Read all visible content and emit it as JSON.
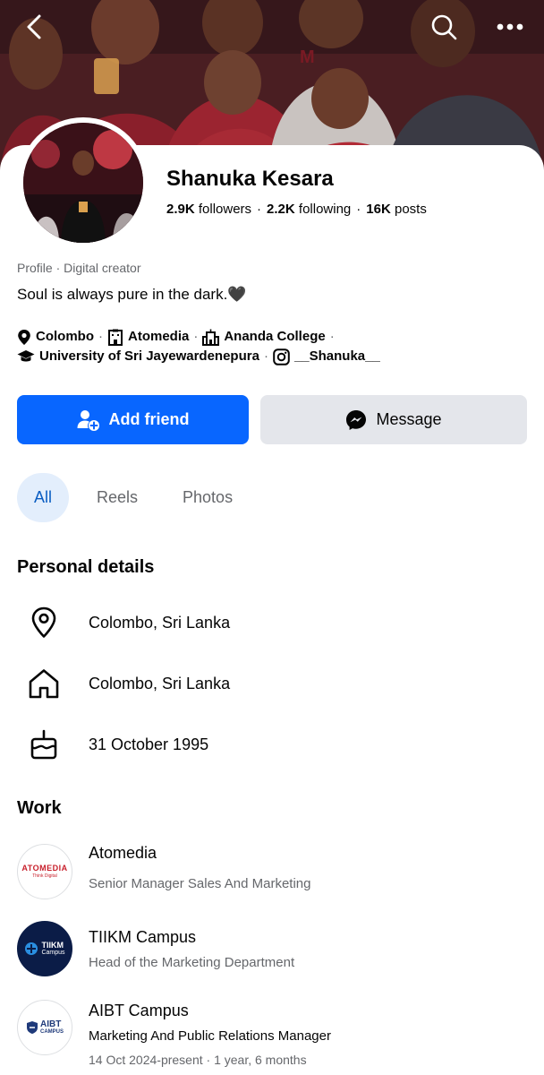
{
  "profile": {
    "name": "Shanuka Kesara",
    "followers_count": "2.9K",
    "followers_label": "followers",
    "following_count": "2.2K",
    "following_label": "following",
    "posts_count": "16K",
    "posts_label": "posts",
    "category": "Profile · Digital creator",
    "bio": "Soul is always pure in the dark.🖤"
  },
  "intro_links": [
    {
      "icon": "location-pin-icon",
      "label": "Colombo"
    },
    {
      "icon": "building-icon",
      "label": "Atomedia"
    },
    {
      "icon": "school-icon",
      "label": "Ananda College"
    },
    {
      "icon": "graduation-cap-icon",
      "label": "University of Sri Jayewardenepura"
    },
    {
      "icon": "instagram-icon",
      "label": "__Shanuka__"
    }
  ],
  "actions": {
    "add_friend": "Add friend",
    "message": "Message"
  },
  "tabs": [
    "All",
    "Reels",
    "Photos"
  ],
  "personal_details": {
    "title": "Personal details",
    "items": [
      {
        "icon": "location-pin-icon",
        "text": "Colombo, Sri Lanka"
      },
      {
        "icon": "home-icon",
        "text": "Colombo, Sri Lanka"
      },
      {
        "icon": "birthday-cake-icon",
        "text": "31 October 1995"
      }
    ]
  },
  "work": {
    "title": "Work",
    "items": [
      {
        "org": "Atomedia",
        "role": "Senior Manager Sales And Marketing",
        "logo_text": "ATOMEDIA",
        "logo_sub": "Think Digital",
        "dates": ""
      },
      {
        "org": "TIIKM Campus",
        "role": "Head of the Marketing Department",
        "logo_text": "TIIKM",
        "logo_sub": "Campus",
        "dates": ""
      },
      {
        "org": "AIBT Campus",
        "role": "Marketing And Public Relations Manager",
        "logo_text": "AIBT",
        "logo_sub": "CAMPUS",
        "dates": "14 Oct 2024-present · 1 year, 6 months"
      }
    ]
  },
  "colors": {
    "primary": "#0866ff",
    "secondary_button": "#e4e6eb",
    "active_tab_bg": "#e3eefc",
    "active_tab_text": "#0a5dc2",
    "muted_text": "#65676b"
  }
}
